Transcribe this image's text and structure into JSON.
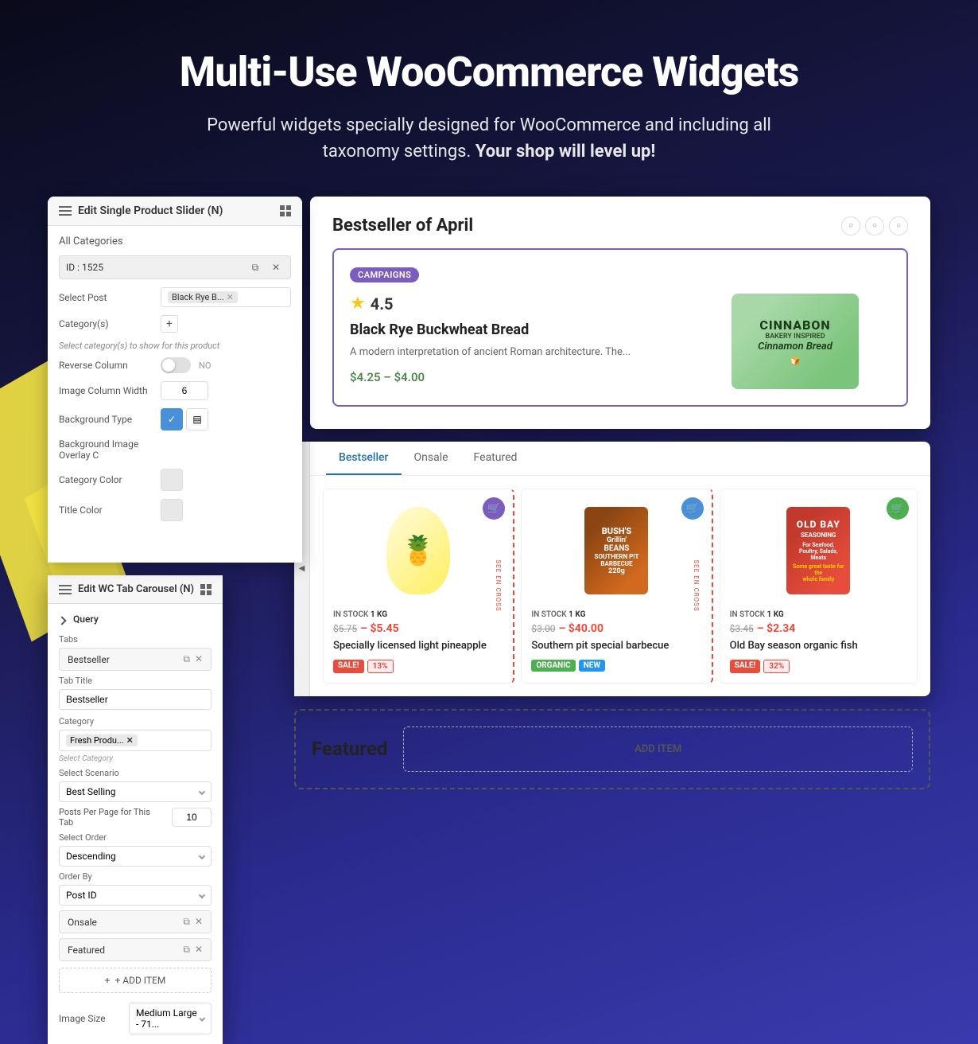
{
  "header": {
    "title": "Multi-Use WooCommerce Widgets",
    "subtitle_start": "Powerful widgets specially designed for WooCommerce and including all taxonomy settings.",
    "subtitle_bold": "Your shop will level up!"
  },
  "panel_left": {
    "title": "Edit Single Product Slider (N)",
    "section_label": "All Categories",
    "id_label": "ID : 1525",
    "select_post_label": "Select Post",
    "select_post_value": "Black Rye B...",
    "category_label": "Category(s)",
    "help_text": "Select category(s) to show for this product",
    "reverse_column_label": "Reverse Column",
    "toggle_off_label": "NO",
    "image_column_label": "Image Column Width",
    "image_column_value": "6",
    "bg_type_label": "Background Type",
    "bg_image_label": "Background Image Overlay C",
    "category_color_label": "Category Color",
    "title_color_label": "Title Color"
  },
  "product_slider": {
    "title": "Bestseller of April",
    "campaign_badge": "CAMPAIGNS",
    "rating": "4.5",
    "product_name": "Black Rye Buckwheat Bread",
    "description": "A modern interpretation of ancient Roman architecture. The...",
    "price": "$4.25 – $4.00",
    "image_brand": "CINNABON\nBAKERY INSPIRED\nCinnamon Bread"
  },
  "tab_carousel": {
    "title": "Edit WC Tab Carousel (N)",
    "query_label": "Query",
    "tabs_label": "Tabs",
    "tab_items": [
      {
        "name": "Bestseller",
        "id": 1
      },
      {
        "name": "Onsale",
        "id": 2
      },
      {
        "name": "Featured",
        "id": 3
      }
    ],
    "tab_title_label": "Tab Title",
    "tab_title_value": "Bestseller",
    "category_label": "Category",
    "category_value": "Fresh Produ...",
    "category_help": "Select Category",
    "scenario_label": "Select Scenario",
    "scenario_value": "Best Selling",
    "posts_per_page_label": "Posts Per Page for This Tab",
    "posts_per_page_value": "10",
    "order_label": "Select Order",
    "order_value": "Descending",
    "order_by_label": "Order By",
    "order_by_value": "Post ID",
    "image_size_label": "Image Size",
    "image_size_value": "Medium Large - 71...",
    "add_item_label": "+ ADD ITEM"
  },
  "preview_tabs": {
    "tabs": [
      "Bestseller",
      "Onsale",
      "Featured"
    ],
    "active_tab": "Bestseller"
  },
  "products": [
    {
      "stock": "IN STOCK",
      "weight": "1 KG",
      "old_price": "$5.75",
      "price": "– $5.45",
      "name": "Specially licensed light pineapple",
      "badges": [
        "SALE!",
        "13%"
      ],
      "cart_color": "purple"
    },
    {
      "stock": "IN STOCK",
      "weight": "1 KG",
      "old_price": "$3.00",
      "price": "– $40.00",
      "name": "Southern pit special barbecue",
      "badges": [
        "ORGANIC",
        "NEW"
      ],
      "cart_color": "blue"
    },
    {
      "stock": "IN STOCK",
      "weight": "1 KG",
      "old_price": "$3.45",
      "price": "– $2.34",
      "name": "Old Bay season organic fish",
      "badges": [
        "SALE!",
        "32%"
      ],
      "cart_color": "green"
    }
  ],
  "featured_text": "Featured",
  "add_item_text": "ADD ITEM",
  "colors": {
    "accent_blue": "#2271b1",
    "accent_purple": "#7c5cbf",
    "sale_red": "#e74c3c",
    "green": "#4caf50"
  }
}
